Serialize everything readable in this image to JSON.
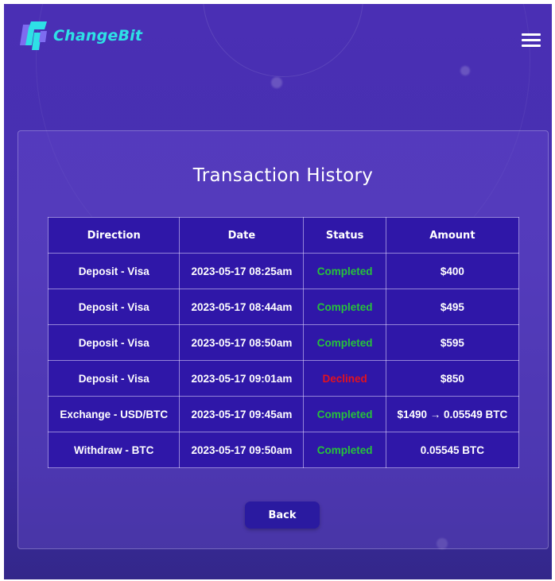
{
  "header": {
    "brand": "ChangeBit",
    "logo_icon": "changebit-logo-icon",
    "menu_icon": "hamburger-menu-icon"
  },
  "page": {
    "title": "Transaction History"
  },
  "table": {
    "columns": [
      "Direction",
      "Date",
      "Status",
      "Amount"
    ],
    "rows": [
      {
        "direction": "Deposit - Visa",
        "date": "2023-05-17 08:25am",
        "status": "Completed",
        "amount": "$400"
      },
      {
        "direction": "Deposit - Visa",
        "date": "2023-05-17 08:44am",
        "status": "Completed",
        "amount": "$495"
      },
      {
        "direction": "Deposit - Visa",
        "date": "2023-05-17 08:50am",
        "status": "Completed",
        "amount": "$595"
      },
      {
        "direction": "Deposit - Visa",
        "date": "2023-05-17 09:01am",
        "status": "Declined",
        "amount": "$850"
      },
      {
        "direction": "Exchange - USD/BTC",
        "date": "2023-05-17 09:45am",
        "status": "Completed",
        "amount": "$1490 → 0.05549 BTC"
      },
      {
        "direction": "Withdraw - BTC",
        "date": "2023-05-17 09:50am",
        "status": "Completed",
        "amount": "0.05545 BTC"
      }
    ]
  },
  "actions": {
    "back_label": "Back"
  },
  "colors": {
    "brand": "#2ee0e6",
    "background": "#4a2fb4",
    "table_bg": "#2f17a8",
    "status_completed": "#27c23a",
    "status_declined": "#e3121e"
  }
}
